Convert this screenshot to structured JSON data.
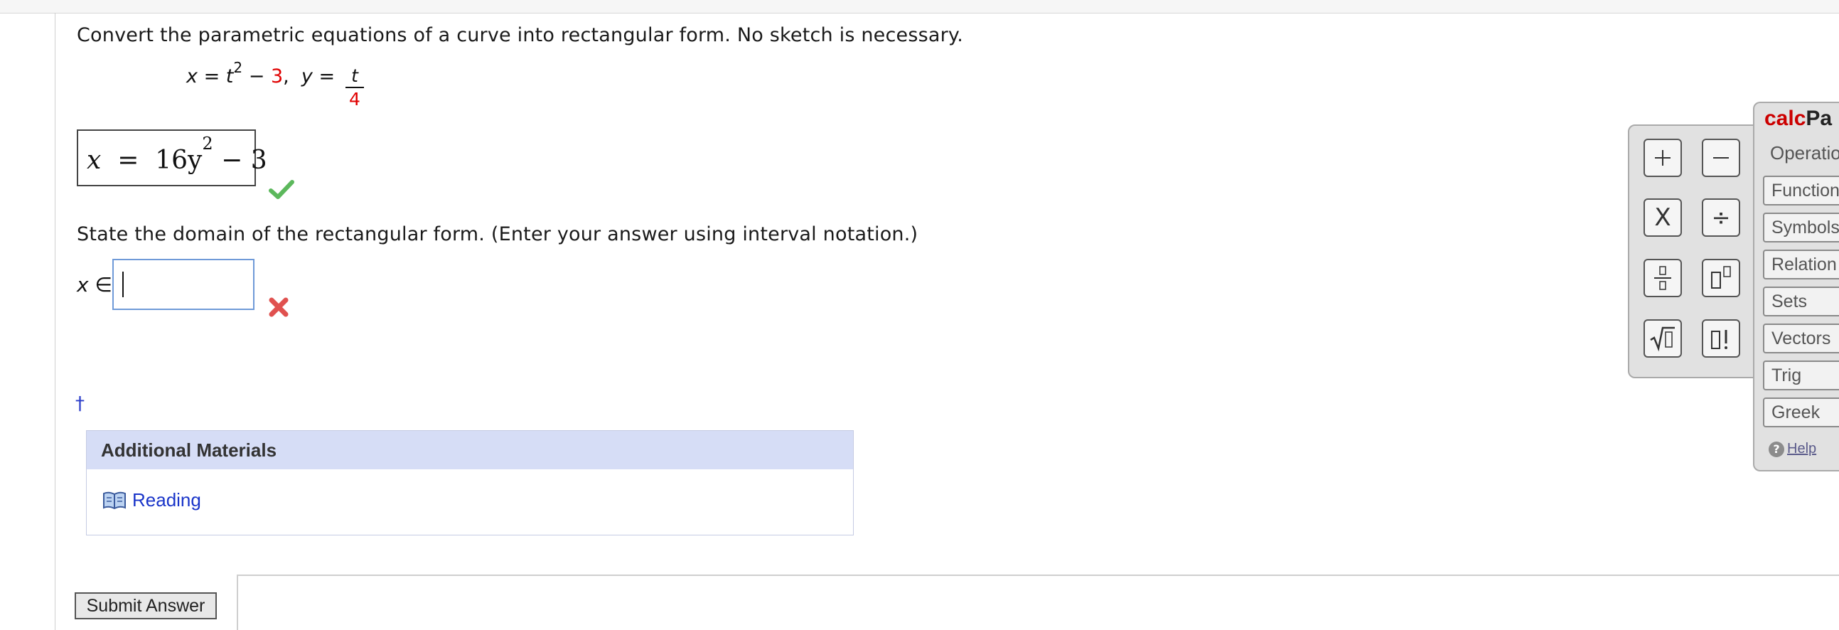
{
  "question": {
    "prompt": "Convert the parametric equations of a curve into rectangular form. No sketch is necessary.",
    "equation": {
      "x_var": "x",
      "eq": "=",
      "t_var": "t",
      "t_exp": "2",
      "minus": "−",
      "const": "3",
      "sep": ",",
      "y_var": "y",
      "frac_num": "t",
      "frac_den": "4"
    },
    "answer1": {
      "lhs": "x",
      "rhs_prefix": "16y",
      "rhs_exp": "2",
      "rhs_suffix": " − 3",
      "status": "correct"
    },
    "domain_prompt": "State the domain of the rectangular form. (Enter your answer using interval notation.)",
    "domain_label_var": "x",
    "domain_label_symbol": "∈",
    "domain_input_value": "",
    "domain_status": "incorrect",
    "dagger": "†"
  },
  "materials": {
    "header": "Additional Materials",
    "reading_label": "Reading",
    "reading_icon": "book-icon"
  },
  "submit_label": "Submit Answer",
  "calcpad": {
    "title_red": "calc",
    "title_dark": "Pa",
    "operations": "Operatio",
    "keys": [
      "+",
      "−",
      "X",
      "÷",
      "fraction",
      "exponent",
      "sqrt",
      "factorial"
    ],
    "categories": [
      "Function",
      "Symbols",
      "Relation",
      "Sets",
      "Vectors",
      "Trig",
      "Greek"
    ],
    "help": "Help"
  },
  "colors": {
    "accent_red": "#e00000",
    "link_blue": "#1a35c9",
    "materials_header_bg": "#d6ddf6",
    "correct_green": "#5cb85c",
    "incorrect_red": "#e0514f"
  }
}
